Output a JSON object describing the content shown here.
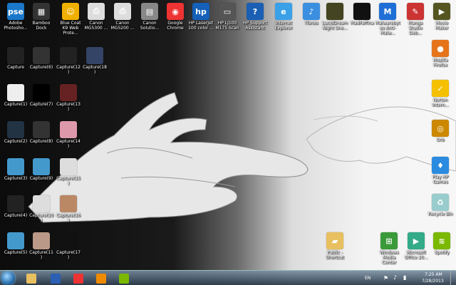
{
  "desktop_icons": [
    {
      "label": "Adobe Photosho...",
      "glyph": "pse",
      "color": "#1a77c9"
    },
    {
      "label": "Bamboo Dock",
      "glyph": "▦",
      "color": "#333"
    },
    {
      "label": "Blue Coat K9 Web Prote...",
      "glyph": "☺",
      "color": "#f0b000"
    },
    {
      "label": "Canon MG5300 ...",
      "glyph": "⎙",
      "color": "#ddd"
    },
    {
      "label": "Canon MG5200 ...",
      "glyph": "⎙",
      "color": "#ddd"
    },
    {
      "label": "Canon Solutio...",
      "glyph": "▤",
      "color": "#888"
    },
    {
      "label": "Google Chrome",
      "glyph": "◉",
      "color": "#e33"
    },
    {
      "label": "HP LaserJet 100 color ...",
      "glyph": "hp",
      "color": "#1560b8"
    },
    {
      "label": "HP LJ100 M175 Scan",
      "glyph": "▭",
      "color": "#555"
    },
    {
      "label": "HP Support Assistant",
      "glyph": "?",
      "color": "#1a5fb4"
    },
    {
      "label": "Internet Explorer",
      "glyph": "e",
      "color": "#3aa0e8"
    },
    {
      "label": "iTunes",
      "glyph": "♪",
      "color": "#3b8fe0"
    },
    {
      "label": "LucidDream Night Sne...",
      "glyph": "",
      "color": "#442"
    },
    {
      "label": "MadFaffina",
      "glyph": "",
      "color": "#111"
    },
    {
      "label": "Malwarebytes Anti-Malw...",
      "glyph": "M",
      "color": "#1f6fd6"
    },
    {
      "label": "Manga Studio Deb...",
      "glyph": "✎",
      "color": "#c33"
    },
    {
      "label": "Movie Maker",
      "glyph": "▶",
      "color": "#552"
    },
    {
      "label": "Capture",
      "glyph": "",
      "color": "#222"
    },
    {
      "label": "Capture(6)",
      "glyph": "",
      "color": "#333"
    },
    {
      "label": "Capture(12)",
      "glyph": "",
      "color": "#222"
    },
    {
      "label": "Capture(18)",
      "glyph": "",
      "color": "#346"
    },
    {
      "label": "Capture(1)",
      "glyph": "",
      "color": "#eee"
    },
    {
      "label": "Capture(7)",
      "glyph": "",
      "color": "#000"
    },
    {
      "label": "Capture(13)",
      "glyph": "",
      "color": "#622"
    },
    {
      "label": "Capture(2)",
      "glyph": "",
      "color": "#234"
    },
    {
      "label": "Capture(8)",
      "glyph": "",
      "color": "#333"
    },
    {
      "label": "Capture(14)",
      "glyph": "",
      "color": "#d9a"
    },
    {
      "label": "Capture(3)",
      "glyph": "",
      "color": "#49c"
    },
    {
      "label": "Capture(9)",
      "glyph": "",
      "color": "#49c"
    },
    {
      "label": "Capture(15)",
      "glyph": "",
      "color": "#ddd"
    },
    {
      "label": "Capture(4)",
      "glyph": "",
      "color": "#222"
    },
    {
      "label": "Capture(10)",
      "glyph": "",
      "color": "#ddd"
    },
    {
      "label": "Capture(16)",
      "glyph": "",
      "color": "#b86"
    },
    {
      "label": "Capture(5)",
      "glyph": "",
      "color": "#49c"
    },
    {
      "label": "Capture(11)",
      "glyph": "",
      "color": "#b98"
    },
    {
      "label": "Capture(17)",
      "glyph": "",
      "color": "#111"
    },
    {
      "label": "Mozilla Firefox",
      "glyph": "●",
      "color": "#e6741b"
    },
    {
      "label": "Norton Intern...",
      "glyph": "✓",
      "color": "#f4c000"
    },
    {
      "label": "Orb",
      "glyph": "◎",
      "color": "#c80"
    },
    {
      "label": "Play HP Games",
      "glyph": "♦",
      "color": "#2a8be0"
    },
    {
      "label": "Recycle Bin",
      "glyph": "♻",
      "color": "#9cc"
    },
    {
      "label": "Public - Shortcut",
      "glyph": "▰",
      "color": "#e8c060"
    },
    {
      "label": "Windows Media Center",
      "glyph": "⊞",
      "color": "#3a9a3a"
    },
    {
      "label": "Microsoft Office 20...",
      "glyph": "▶",
      "color": "#3a8"
    },
    {
      "label": "Spotify",
      "glyph": "≋",
      "color": "#7ab900"
    }
  ],
  "taskbar": {
    "pinned": [
      {
        "name": "windows-explorer",
        "color": "#e8c060"
      },
      {
        "name": "microsoft-word",
        "color": "#2a5fb4"
      },
      {
        "name": "google-chrome",
        "color": "#e33"
      },
      {
        "name": "media-player",
        "color": "#f08a00"
      },
      {
        "name": "spotify",
        "color": "#7ab900"
      }
    ],
    "language": "EN",
    "time": "7:25 AM",
    "date": "7/28/2013"
  }
}
